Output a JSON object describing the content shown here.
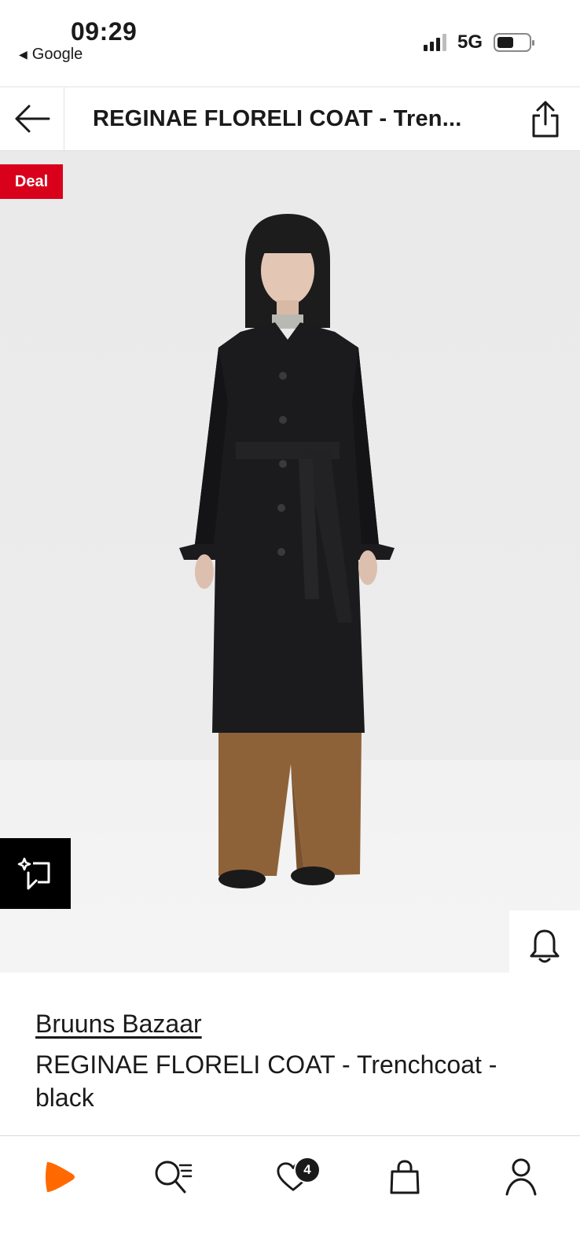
{
  "status_bar": {
    "time": "09:29",
    "back_app": "Google",
    "network": "5G",
    "battery_level": 0.5
  },
  "header": {
    "title": "REGINAE FLORELI COAT - Tren...",
    "back_icon": "arrow-left-icon",
    "share_icon": "share-icon"
  },
  "gallery": {
    "deal_badge": "Deal",
    "deal_color": "#d9001b",
    "progress": 0.12,
    "side_actions": [
      "bell-icon",
      "heart-icon",
      "shopping-bag-icon"
    ],
    "compare_icon": "compare-icon"
  },
  "product": {
    "brand": "Bruuns Bazaar",
    "name": "REGINAE FLORELI COAT - Trenchcoat - black"
  },
  "tab_bar": {
    "items": [
      {
        "icon": "zalando-logo-icon"
      },
      {
        "icon": "search-icon"
      },
      {
        "icon": "wishlist-icon",
        "badge": "4"
      },
      {
        "icon": "bag-icon"
      },
      {
        "icon": "profile-icon"
      }
    ],
    "brand_color": "#ff6900"
  }
}
